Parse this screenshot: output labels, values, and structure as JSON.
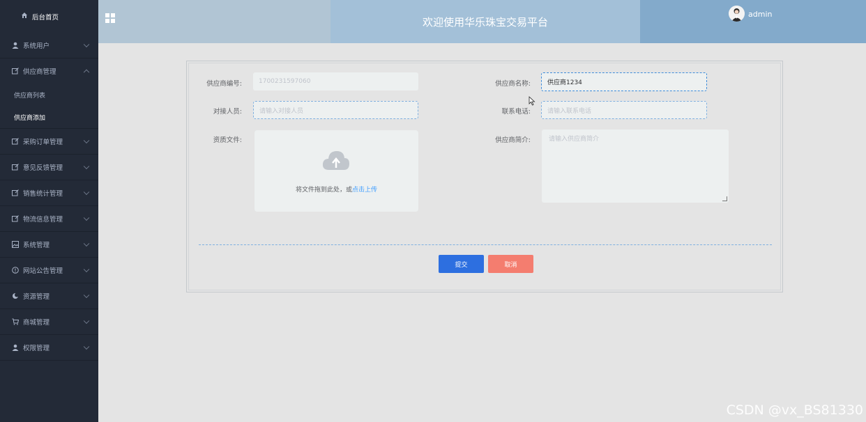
{
  "sidebar": {
    "home_label": "后台首页",
    "items": [
      {
        "label": "系统用户",
        "icon": "user-icon"
      },
      {
        "label": "供应商管理",
        "icon": "edit-box-icon",
        "expanded": true,
        "children": [
          {
            "label": "供应商列表"
          },
          {
            "label": "供应商添加",
            "active": true
          }
        ]
      },
      {
        "label": "采购订单管理",
        "icon": "edit-box-icon"
      },
      {
        "label": "意见反馈管理",
        "icon": "edit-box-icon"
      },
      {
        "label": "销售统计管理",
        "icon": "edit-box-icon"
      },
      {
        "label": "物流信息管理",
        "icon": "edit-box-icon"
      },
      {
        "label": "系统管理",
        "icon": "picture-icon"
      },
      {
        "label": "网站公告管理",
        "icon": "info-circle-icon"
      },
      {
        "label": "资源管理",
        "icon": "moon-icon"
      },
      {
        "label": "商城管理",
        "icon": "cart-icon"
      },
      {
        "label": "权限管理",
        "icon": "user-icon"
      }
    ]
  },
  "header": {
    "title": "欢迎使用华乐珠宝交易平台",
    "username": "admin"
  },
  "form": {
    "supplier_no_label": "供应商编号:",
    "supplier_no_value": "1700231597060",
    "supplier_name_label": "供应商名称:",
    "supplier_name_value": "供应商1234",
    "contact_label": "对接人员:",
    "contact_placeholder": "请输入对接人员",
    "phone_label": "联系电话:",
    "phone_placeholder": "请输入联系电话",
    "qualification_label": "资质文件:",
    "upload_text": "将文件拖到此处，或",
    "upload_link": "点击上传",
    "intro_label": "供应商简介:",
    "intro_placeholder": "请输入供应商简介",
    "submit_label": "提交",
    "cancel_label": "取消"
  },
  "watermark": "CSDN @vx_BS81330",
  "colors": {
    "sidebar_bg": "#232a37",
    "submit": "#2d6fe0",
    "cancel": "#f47d6f",
    "link": "#409eff"
  }
}
